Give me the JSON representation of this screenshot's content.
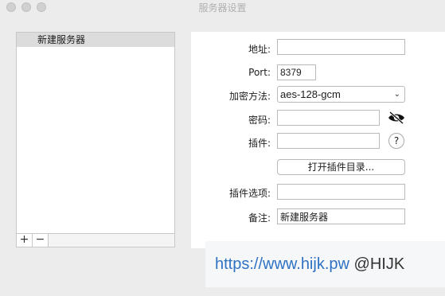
{
  "window": {
    "title": "服务器设置"
  },
  "server_list": {
    "items": [
      {
        "label": "新建服务器",
        "selected": true
      }
    ],
    "add_label": "+",
    "remove_label": "−"
  },
  "settings": {
    "address_label": "地址:",
    "address_value": "",
    "port_label": "Port:",
    "port_value": "8379",
    "encryption_label": "加密方法:",
    "encryption_value": "aes-128-gcm",
    "password_label": "密码:",
    "password_value": "",
    "plugin_label": "插件:",
    "plugin_value": "",
    "help_label": "?",
    "open_plugin_dir_label": "打开插件目录...",
    "plugin_options_label": "插件选项:",
    "plugin_options_value": "",
    "remarks_label": "备注:",
    "remarks_value": "新建服务器"
  },
  "watermark": {
    "url": "https://www.hijk.pw",
    "handle": "@HIJK"
  },
  "colors": {
    "background": "#ececec",
    "watermark_url": "#2f72c4"
  }
}
